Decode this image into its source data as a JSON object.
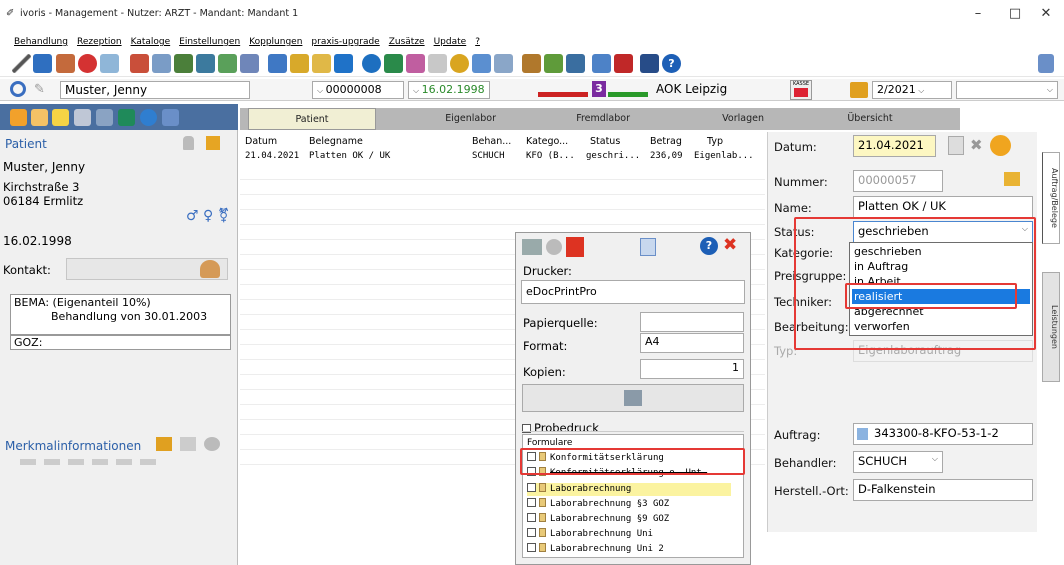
{
  "window": {
    "title": "ivoris - Management - Nutzer: ARZT - Mandant: Mandant 1",
    "min": "–",
    "max": "□",
    "close": "✕"
  },
  "menu": [
    "Behandlung",
    "Rezeption",
    "Kataloge",
    "Einstellungen",
    "Kopplungen",
    "praxis-upgrade",
    "Zusätze",
    "Update",
    "?"
  ],
  "addrbar": {
    "patient": "Muster, Jenny",
    "number": "00000008",
    "birth": "16.02.1998",
    "insurance": "AOK Leipzig",
    "badge": "3",
    "kasse": "KASSE",
    "quarter": "2/2021"
  },
  "left": {
    "heading": "Patient",
    "name": "Muster, Jenny",
    "street": "Kirchstraße 3",
    "city": "06184 Ermlitz",
    "birth": "16.02.1998",
    "contact_label": "Kontakt:",
    "bema": "BEMA: (Eigenanteil 10%)",
    "behandlung": "Behandlung von 30.01.2003",
    "goz": "GOZ:",
    "merkmal": "Merkmalinformationen"
  },
  "tabs": [
    "Patient",
    "Eigenlabor",
    "Fremdlabor",
    "Vorlagen",
    "Übersicht"
  ],
  "grid": {
    "headers": [
      "Datum",
      "Belegname",
      "Behan...",
      "Katego...",
      "Status",
      "Betrag",
      "Typ"
    ],
    "row": [
      "21.04.2021",
      "Platten OK / UK",
      "SCHUCH",
      "KFO (B...",
      "geschri...",
      "236,09",
      "Eigenlab..."
    ]
  },
  "detail": {
    "datum_label": "Datum:",
    "datum": "21.04.2021",
    "nummer_label": "Nummer:",
    "nummer": "00000057",
    "name_label": "Name:",
    "name": "Platten OK / UK",
    "status_label": "Status:",
    "status": "geschrieben",
    "kategorie_label": "Kategorie:",
    "preisgruppe_label": "Preisgruppe:",
    "techniker_label": "Techniker:",
    "bearbeitung_label": "Bearbeitung:",
    "typ_label": "Typ:",
    "typ": "Eigenlaborauftrag",
    "auftrag_label": "Auftrag:",
    "auftrag": "343300-8-KFO-53-1-2",
    "behandler_label": "Behandler:",
    "behandler": "SCHUCH",
    "herstell_label": "Herstell.-Ort:",
    "herstell": "D-Falkenstein",
    "vtab1": "Auftrag/Belege",
    "vtab2": "Leistungen"
  },
  "status_options": [
    "geschrieben",
    "in Auftrag",
    "in Arbeit",
    "realisiert",
    "abgerechnet",
    "verworfen"
  ],
  "print": {
    "drucker_label": "Drucker:",
    "drucker": "eDocPrintPro",
    "papier_label": "Papierquelle:",
    "format_label": "Format:",
    "format": "A4",
    "kopien_label": "Kopien:",
    "kopien": "1",
    "probedruck": "Probedruck",
    "formulare_label": "Formulare",
    "forms": [
      "Konformitätserklärung",
      "Konformitätserklärung o. Unt.",
      "Laborabrechnung",
      "Laborabrechnung §3 GOZ",
      "Laborabrechnung §9 GOZ",
      "Laborabrechnung Uni",
      "Laborabrechnung Uni 2"
    ]
  }
}
